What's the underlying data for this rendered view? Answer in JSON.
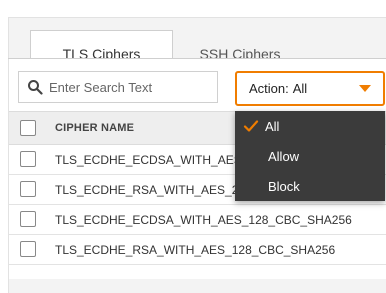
{
  "tabs": [
    {
      "label": "TLS Ciphers"
    },
    {
      "label": "SSH Ciphers"
    }
  ],
  "search": {
    "placeholder": "Enter Search Text",
    "value": ""
  },
  "action_filter": {
    "label": "Action:",
    "value": "All"
  },
  "table": {
    "header": "CIPHER NAME",
    "rows": [
      {
        "name": "TLS_ECDHE_ECDSA_WITH_AES_256_CBC_SHA384"
      },
      {
        "name": "TLS_ECDHE_RSA_WITH_AES_256_CBC_SHA384"
      },
      {
        "name": "TLS_ECDHE_ECDSA_WITH_AES_128_CBC_SHA256"
      },
      {
        "name": "TLS_ECDHE_RSA_WITH_AES_128_CBC_SHA256"
      }
    ]
  },
  "dropdown": {
    "options": [
      {
        "label": "All",
        "selected": true
      },
      {
        "label": "Allow",
        "selected": false
      },
      {
        "label": "Block",
        "selected": false
      }
    ]
  },
  "colors": {
    "accent": "#f07d00",
    "menu_bg": "#3b3b3b"
  }
}
